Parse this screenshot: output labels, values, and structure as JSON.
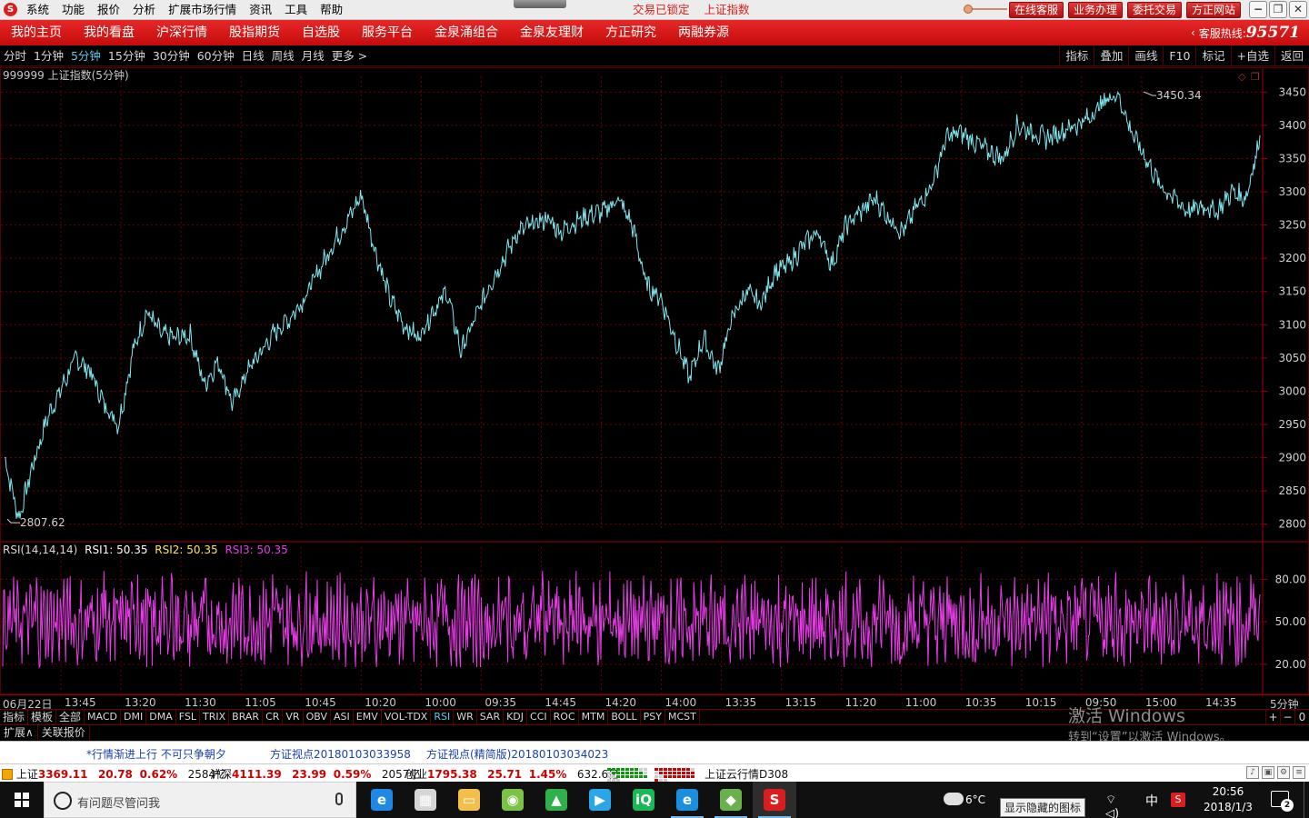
{
  "menu": {
    "logo": "S",
    "items": [
      "系统",
      "功能",
      "报价",
      "分析",
      "扩展市场行情",
      "资讯",
      "工具",
      "帮助"
    ],
    "status_locked": "交易已锁定",
    "status_index": "上证指数",
    "quick_buttons": [
      "在线客服",
      "业务办理",
      "委托交易",
      "方正网站"
    ],
    "window_buttons": [
      "−",
      "❐",
      "✕"
    ]
  },
  "nav": {
    "items": [
      "我的主页",
      "我的看盘",
      "沪深行情",
      "股指期货",
      "自选股",
      "服务平台",
      "金泉涌组合",
      "金泉友理财",
      "方正研究",
      "两融券源"
    ],
    "hotline_label": "客服热线:",
    "hotline_number": "95571"
  },
  "period_bar": {
    "periods": [
      "分时",
      "1分钟",
      "5分钟",
      "15分钟",
      "30分钟",
      "60分钟",
      "日线",
      "周线",
      "月线",
      "更多 >"
    ],
    "active_index": 2,
    "tools": [
      "指标",
      "叠加",
      "画线",
      "F10",
      "标记",
      "+自选",
      "返回"
    ]
  },
  "main_chart": {
    "title": "999999 上证指数(5分钟)",
    "high_label": "3450.34",
    "low_label": "2807.62"
  },
  "rsi": {
    "label": "RSI(14,14,14)",
    "rsi1": "RSI1: 50.35",
    "rsi2": "RSI2: 50.35",
    "rsi3": "RSI3: 50.35"
  },
  "chart_data": [
    {
      "type": "line",
      "title": "999999 上证指数(5分钟)",
      "y_ticks": [
        3450,
        3400,
        3350,
        3300,
        3250,
        3200,
        3150,
        3100,
        3050,
        3000,
        2950,
        2900,
        2850,
        2800
      ],
      "ylim": [
        2790,
        3460
      ],
      "x_ticks": [
        "06月22日",
        "13:45",
        "13:20",
        "11:30",
        "11:05",
        "10:45",
        "10:20",
        "10:00",
        "09:35",
        "14:45",
        "14:20",
        "14:00",
        "13:35",
        "13:15",
        "11:20",
        "11:00",
        "10:35",
        "10:15",
        "09:50",
        "15:00",
        "14:35"
      ],
      "x_axis_unit": "5分钟",
      "grid": true,
      "series": [
        {
          "name": "上证指数",
          "color": "#7fe6ef",
          "values": [
            2900,
            2808,
            2890,
            2960,
            3005,
            3050,
            3030,
            2980,
            2950,
            3060,
            3120,
            3085,
            3080,
            3085,
            3010,
            3045,
            2980,
            3030,
            3060,
            3090,
            3110,
            3140,
            3180,
            3220,
            3255,
            3295,
            3210,
            3140,
            3100,
            3080,
            3120,
            3150,
            3060,
            3110,
            3160,
            3200,
            3240,
            3250,
            3260,
            3240,
            3255,
            3265,
            3270,
            3290,
            3250,
            3160,
            3140,
            3080,
            3020,
            3080,
            3030,
            3110,
            3150,
            3130,
            3180,
            3190,
            3220,
            3240,
            3190,
            3250,
            3270,
            3290,
            3260,
            3240,
            3280,
            3310,
            3380,
            3390,
            3375,
            3360,
            3350,
            3400,
            3390,
            3380,
            3390,
            3400,
            3410,
            3435,
            3450,
            3390,
            3350,
            3310,
            3290,
            3270,
            3280,
            3270,
            3300,
            3290,
            3380
          ]
        }
      ]
    },
    {
      "type": "line",
      "title": "RSI(14,14,14)",
      "y_ticks": [
        80,
        50,
        20
      ],
      "ylim": [
        0,
        95
      ],
      "grid": true,
      "series": [
        {
          "name": "RSI1",
          "color": "#e63be6",
          "value_label": "50.35",
          "min": 18,
          "max": 86
        },
        {
          "name": "RSI2",
          "color": "#ffeb3b",
          "value_label": "50.35"
        },
        {
          "name": "RSI3",
          "color": "#e63be6",
          "value_label": "50.35"
        }
      ]
    }
  ],
  "indicator_tabs": {
    "items": [
      "指标",
      "模板",
      "全部",
      "MACD",
      "DMI",
      "DMA",
      "FSL",
      "TRIX",
      "BRAR",
      "CR",
      "VR",
      "OBV",
      "ASI",
      "EMV",
      "VOL-TDX",
      "RSI",
      "WR",
      "SAR",
      "KDJ",
      "CCI",
      "ROC",
      "MTM",
      "BOLL",
      "PSY",
      "MCST"
    ],
    "active": "RSI",
    "right_buttons": [
      "+",
      "−",
      "0"
    ]
  },
  "ext_tabs": [
    "扩展∧",
    "关联报价"
  ],
  "watermark": {
    "line1": "激活 Windows",
    "line2": "转到“设置”以激活 Windows。"
  },
  "news": [
    "*行情渐进上行    不可只争朝夕",
    "方证视点20180103033958",
    "方证视点(精简版)20180103034023"
  ],
  "index_bar": {
    "sh_label": "上证",
    "sh_value": "3369.11",
    "sh_change": "20.78",
    "sh_pct": "0.62%",
    "sh_amount": "2584亿",
    "hs_label": "沪深",
    "hs_value": "4111.39",
    "hs_change": "23.99",
    "hs_pct": "0.59%",
    "hs_amount": "2057亿",
    "cy_label": "创业",
    "cy_value": "1795.38",
    "cy_change": "25.71",
    "cy_pct": "1.45%",
    "cy_amount": "632.6亿",
    "cloud_label": "上证云行情D308"
  },
  "taskbar": {
    "search_placeholder": "有问题尽管问我",
    "apps": [
      {
        "name": "edge",
        "color": "#1e88e5",
        "glyph": "e"
      },
      {
        "name": "store",
        "color": "#d6d6d6",
        "glyph": "▦"
      },
      {
        "name": "explorer",
        "color": "#f2c04a",
        "glyph": "▭"
      },
      {
        "name": "browser-360",
        "color": "#7cc246",
        "glyph": "◉"
      },
      {
        "name": "green-app",
        "color": "#2fb14a",
        "glyph": "▲"
      },
      {
        "name": "video-player",
        "color": "#2aa6e8",
        "glyph": "▶"
      },
      {
        "name": "iqiyi",
        "color": "#19b955",
        "glyph": "iQ"
      },
      {
        "name": "ie",
        "color": "#1a8fe0",
        "glyph": "e"
      },
      {
        "name": "network-app",
        "color": "#6ab04c",
        "glyph": "◆"
      },
      {
        "name": "founder-app",
        "color": "#d81e1e",
        "glyph": "S"
      }
    ],
    "temperature": "6°C",
    "tooltip": "显示隐藏的图标",
    "ime": "中",
    "time": "20:56",
    "date": "2018/1/3",
    "notifications": "2"
  },
  "colors": {
    "price_line": "#7fe6ef",
    "rsi_line": "#e63be6",
    "rsi2": "#ffeb3b",
    "grid": "#6b0000",
    "accent_red": "#d81e1e"
  }
}
